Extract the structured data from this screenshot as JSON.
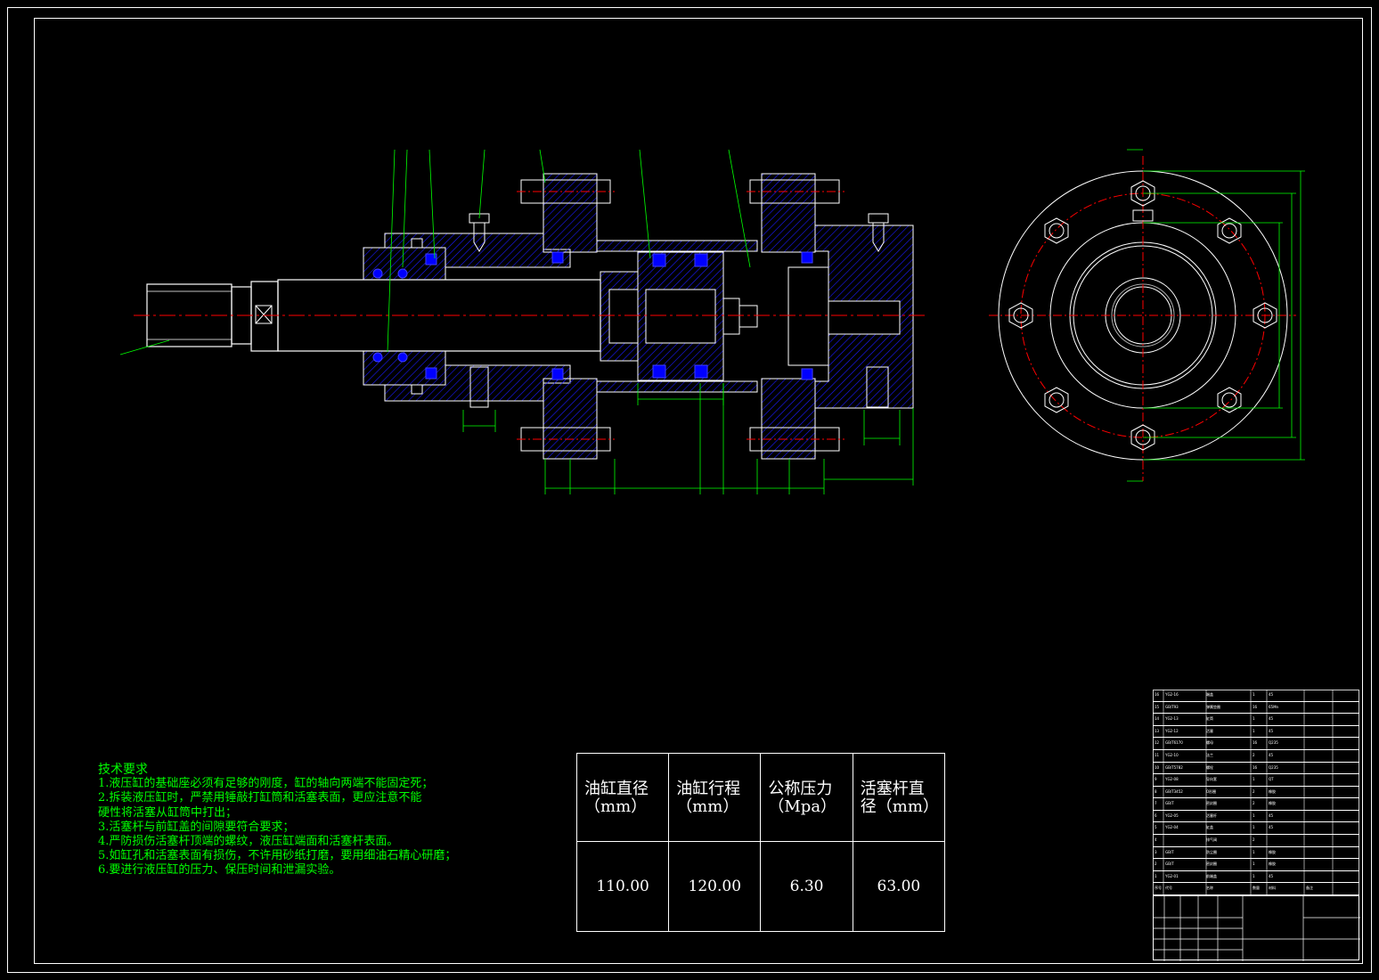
{
  "technical_requirements": {
    "title": "技术要求",
    "items": [
      "1.液压缸的基础座必须有足够的刚度，缸的轴向两端不能固定死；",
      "2.拆装液压缸时，严禁用锤敲打缸筒和活塞表面，更应注意不能",
      "硬性将活塞从缸筒中打出；",
      "3.活塞杆与前缸盖的间隙要符合要求；",
      "4.严防损伤活塞杆顶端的螺纹，液压缸端面和活塞杆表面。",
      "5.如缸孔和活塞表面有损伤，不许用砂纸打磨，要用细油石精心研磨；",
      "6.要进行液压缸的压力、保压时间和泄漏实验。"
    ]
  },
  "spec_table": {
    "headers": [
      {
        "line1": "油缸直径",
        "line2": "（mm）"
      },
      {
        "line1": "油缸行程",
        "line2": "（mm）"
      },
      {
        "line1": "公称压力",
        "line2": "（Mpa）"
      },
      {
        "line1": "活塞杆直",
        "line2": "径（mm）"
      }
    ],
    "values": [
      "110.00",
      "120.00",
      "6.30",
      "63.00"
    ]
  },
  "parts_list": {
    "rows": [
      {
        "no": "16",
        "code": "YG2-16",
        "name": "端盖",
        "qty": "1",
        "material": "45",
        "note": ""
      },
      {
        "no": "15",
        "code": "GB/T93",
        "name": "弹簧垫圈",
        "qty": "16",
        "material": "65Mn",
        "note": ""
      },
      {
        "no": "14",
        "code": "YG2-13",
        "name": "缸筒",
        "qty": "1",
        "material": "45",
        "note": ""
      },
      {
        "no": "13",
        "code": "YG2-12",
        "name": "活塞",
        "qty": "1",
        "material": "45",
        "note": ""
      },
      {
        "no": "12",
        "code": "GB/T6170",
        "name": "螺母",
        "qty": "16",
        "material": "Q235",
        "note": ""
      },
      {
        "no": "11",
        "code": "YG2-10",
        "name": "法兰",
        "qty": "2",
        "material": "45",
        "note": ""
      },
      {
        "no": "10",
        "code": "GB/T5782",
        "name": "螺栓",
        "qty": "16",
        "material": "Q235",
        "note": ""
      },
      {
        "no": "9",
        "code": "YG2-08",
        "name": "导向套",
        "qty": "1",
        "material": "QT",
        "note": ""
      },
      {
        "no": "8",
        "code": "GB/T3452",
        "name": "O形圈",
        "qty": "2",
        "material": "橡胶",
        "note": ""
      },
      {
        "no": "7",
        "code": "GB/T",
        "name": "密封圈",
        "qty": "2",
        "material": "橡胶",
        "note": ""
      },
      {
        "no": "6",
        "code": "YG2-05",
        "name": "活塞杆",
        "qty": "1",
        "material": "45",
        "note": ""
      },
      {
        "no": "5",
        "code": "YG2-04",
        "name": "缸盖",
        "qty": "1",
        "material": "45",
        "note": ""
      },
      {
        "no": "4",
        "code": "",
        "name": "排气阀",
        "qty": "2",
        "material": "",
        "note": ""
      },
      {
        "no": "3",
        "code": "GB/T",
        "name": "防尘圈",
        "qty": "1",
        "material": "橡胶",
        "note": ""
      },
      {
        "no": "2",
        "code": "GB/T",
        "name": "密封圈",
        "qty": "1",
        "material": "橡胶",
        "note": ""
      },
      {
        "no": "1",
        "code": "YG2-01",
        "name": "前端盖",
        "qty": "1",
        "material": "45",
        "note": ""
      }
    ],
    "header": {
      "no": "序号",
      "code": "代号",
      "name": "名称",
      "qty": "数量",
      "material": "材料",
      "note": "备注"
    }
  },
  "colors": {
    "line": "#ffffff",
    "hatch": "#0000ff",
    "dimension": "#00ff00",
    "center": "#ff0000",
    "seal": "#0000ff"
  }
}
